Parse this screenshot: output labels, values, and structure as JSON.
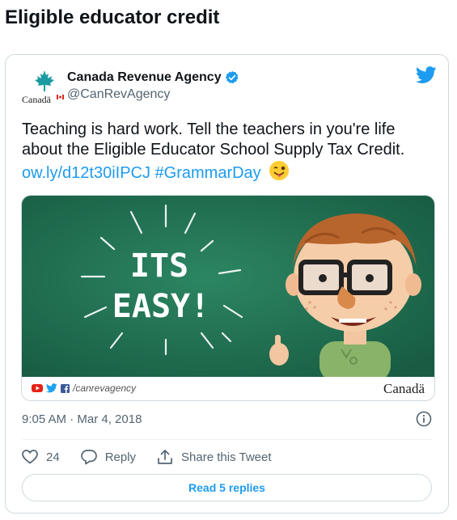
{
  "page": {
    "title": "Eligible educator credit"
  },
  "tweet": {
    "author": {
      "name": "Canada Revenue Agency",
      "handle": "@CanRevAgency",
      "logo_wordmark": "Canadä"
    },
    "text": "Teaching is hard work. Tell the teachers in you're life about the Eligible Educator School Supply Tax Credit.",
    "link": "ow.ly/d12t30iIPCJ",
    "hashtag": "#GrammarDay",
    "emoji": "winking-face-with-tongue",
    "media": {
      "headline": [
        "ITS",
        "EASY!"
      ],
      "social_handle": "/canrevagency",
      "wordmark": "Canadä"
    },
    "timestamp": "9:05 AM · Mar 4, 2018",
    "likes": "24",
    "reply_label": "Reply",
    "share_label": "Share this Tweet",
    "read_replies_label": "Read 5 replies"
  },
  "colors": {
    "link": "#1d9bf0",
    "chalkboard": "#1f6b4f",
    "muted": "#536471"
  },
  "icons": [
    "maple-leaf-icon",
    "verified-badge-icon",
    "twitter-bird-icon",
    "heart-icon",
    "reply-icon",
    "share-icon",
    "info-icon",
    "youtube-icon",
    "twitter-icon",
    "facebook-icon"
  ]
}
